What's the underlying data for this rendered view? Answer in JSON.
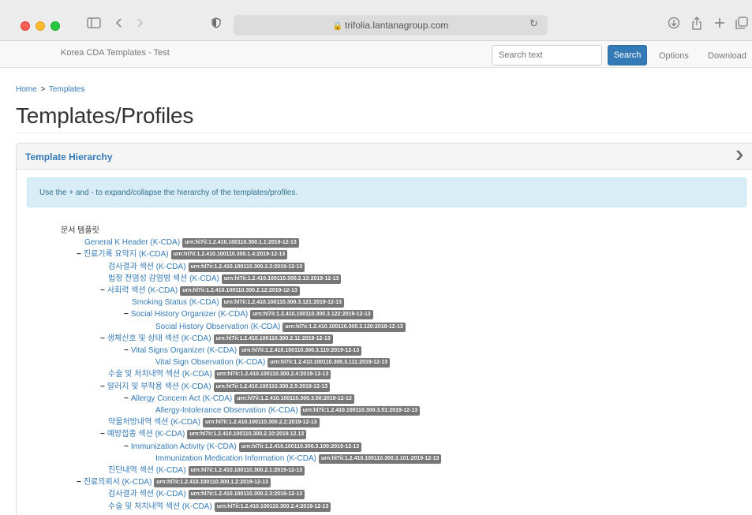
{
  "browser": {
    "url": "trifolia.lantanagroup.com",
    "icons": {
      "sidebar": "sidebar-icon",
      "back": "chevron-left-icon",
      "forward": "chevron-right-icon",
      "shield": "shield-icon",
      "lock": "lock-icon",
      "reload": "reload-icon",
      "download": "download-icon",
      "share": "share-icon",
      "new_tab": "plus-icon",
      "tabs": "tabs-icon"
    }
  },
  "navbar": {
    "brand": "Korea CDA Templates - Test",
    "search_placeholder": "Search text",
    "search_button": "Search",
    "options": "Options",
    "download": "Download"
  },
  "breadcrumb": {
    "home": "Home",
    "separator": ">",
    "current": "Templates"
  },
  "page_title": "Templates/Profiles",
  "panel": {
    "title": "Template Hierarchy",
    "chevron": "chevron-down-icon",
    "info": "Use the + and - to expand/collapse the hierarchy of the templates/profiles."
  },
  "tree": [
    {
      "level": 0,
      "toggle": "",
      "name": "문서 템플릿",
      "oid": "",
      "plain": true
    },
    {
      "level": 1,
      "toggle": "",
      "name": "General K Header (K-CDA)",
      "oid": "urn:hl7ii:1.2.410.100110.300.1.1:2019-12-13"
    },
    {
      "level": 1,
      "toggle": "−",
      "name": "진료기록 요약지 (K-CDA)",
      "oid": "urn:hl7ii:1.2.410.100110.300.1.4:2019-12-13"
    },
    {
      "level": 2,
      "toggle": "",
      "name": "검사결과 섹션 (K-CDA)",
      "oid": "urn:hl7ii:1.2.410.100110.300.2.3:2019-12-13"
    },
    {
      "level": 2,
      "toggle": "",
      "name": "법정 전염성 감염병 섹션 (K-CDA)",
      "oid": "urn:hl7ii:1.2.410.100110.300.2.13:2019-12-13"
    },
    {
      "level": 2,
      "toggle": "−",
      "name": "사회력 섹션 (K-CDA)",
      "oid": "urn:hl7ii:1.2.410.100110.300.2.12:2019-12-13"
    },
    {
      "level": 3,
      "toggle": "",
      "name": "Smoking Status (K-CDA)",
      "oid": "urn:hl7ii:1.2.410.100110.300.3.121:2019-12-13"
    },
    {
      "level": 3,
      "toggle": "−",
      "name": "Social History Organizer (K-CDA)",
      "oid": "urn:hl7ii:1.2.410.100110.300.3.122:2019-12-13"
    },
    {
      "level": 4,
      "toggle": "",
      "name": "Social History Observation (K-CDA)",
      "oid": "urn:hl7ii:1.2.410.100110.300.3.120:2019-12-13"
    },
    {
      "level": 2,
      "toggle": "−",
      "name": "생체신호 및 상태 섹션 (K-CDA)",
      "oid": "urn:hl7ii:1.2.410.100110.300.2.11:2019-12-13"
    },
    {
      "level": 3,
      "toggle": "−",
      "name": "Vital Signs Organizer (K-CDA)",
      "oid": "urn:hl7ii:1.2.410.100110.300.3.110:2019-12-13"
    },
    {
      "level": 4,
      "toggle": "",
      "name": "Vital Sign Observation (K-CDA)",
      "oid": "urn:hl7ii:1.2.410.100110.300.3.111:2019-12-13"
    },
    {
      "level": 2,
      "toggle": "",
      "name": "수술 및 처치내역 섹션 (K-CDA)",
      "oid": "urn:hl7ii:1.2.410.100110.300.2.4:2019-12-13"
    },
    {
      "level": 2,
      "toggle": "−",
      "name": "알러지 및 부작용 섹션 (K-CDA)",
      "oid": "urn:hl7ii:1.2.410.100110.300.2.5:2019-12-13"
    },
    {
      "level": 3,
      "toggle": "−",
      "name": "Allergy Concern Act (K-CDA)",
      "oid": "urn:hl7ii:1.2.410.100110.300.3.50:2019-12-13"
    },
    {
      "level": 4,
      "toggle": "",
      "name": "Allergy-Intolerance Observation (K-CDA)",
      "oid": "urn:hl7ii:1.2.410.100110.300.3.51:2019-12-13"
    },
    {
      "level": 2,
      "toggle": "",
      "name": "약물처방내역 섹션 (K-CDA)",
      "oid": "urn:hl7ii:1.2.410.100110.300.2.2:2019-12-13"
    },
    {
      "level": 2,
      "toggle": "−",
      "name": "예방접종 섹션 (K-CDA)",
      "oid": "urn:hl7ii:1.2.410.100110.300.2.10:2019.12.13"
    },
    {
      "level": 3,
      "toggle": "−",
      "name": "Immunization Activity (K-CDA)",
      "oid": "urn:hl7ii:1.2.410.100110.300.3.100:2019-12-13"
    },
    {
      "level": 4,
      "toggle": "",
      "name": "Immunization Medication Information (K-CDA)",
      "oid": "urn:hl7ii:1.2.410.100110.300.3.101:2019-12-13"
    },
    {
      "level": 2,
      "toggle": "",
      "name": "진단내역 섹션 (K-CDA)",
      "oid": "urn:hl7ii:1.2.410.100110.300.2.1:2019-12-13"
    },
    {
      "level": 1,
      "toggle": "−",
      "name": "진료의뢰서 (K-CDA)",
      "oid": "urn:hl7ii:1.2.410.100110.300.1.2:2019-12-13"
    },
    {
      "level": 2,
      "toggle": "",
      "name": "검사결과 섹션 (K-CDA)",
      "oid": "urn:hl7ii:1.2.410.100110.300.2.3:2019-12-13"
    },
    {
      "level": 2,
      "toggle": "",
      "name": "수술 및 처치내역 섹션 (K-CDA)",
      "oid": "urn:hl7ii:1.2.410.100110.300.2.4:2019-12-13"
    }
  ]
}
